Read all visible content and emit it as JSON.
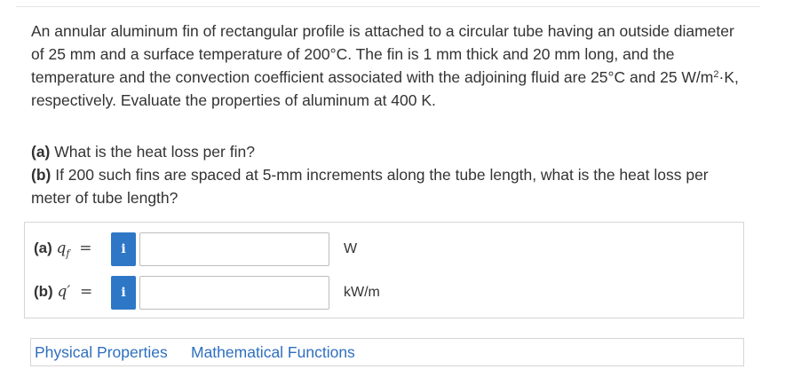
{
  "problem": {
    "text_before_sup": "An annular aluminum fin of rectangular profile is attached to a circular tube having an outside diameter of 25 mm and a surface temperature of 200°C. The fin is 1 mm thick and 20 mm long, and the temperature and the convection coefficient associated with the adjoining fluid are 25°C and 25 W/m",
    "sup": "2",
    "text_after_sup": "·K, respectively. Evaluate the properties of aluminum at 400 K."
  },
  "questions": [
    {
      "part": "(a)",
      "text": " What is the heat loss per fin?"
    },
    {
      "part": "(b)",
      "text": " If 200 such fins are spaced at 5-mm increments along the tube length, what is the heat loss per meter of tube length?"
    }
  ],
  "answers": [
    {
      "part": "(a)",
      "symbol": "q",
      "subscript": "f",
      "equals": "=",
      "info": "i",
      "value": "",
      "unit": "W"
    },
    {
      "part": "(b)",
      "symbol": "q",
      "prime": "′",
      "equals": "=",
      "info": "i",
      "value": "",
      "unit": "kW/m"
    }
  ],
  "links": {
    "physical_properties": "Physical Properties",
    "mathematical_functions": "Mathematical Functions"
  },
  "colors": {
    "info_button": "#2e77c7",
    "link": "#2e6fbf",
    "text": "#333333",
    "border": "#d5d5d5"
  }
}
